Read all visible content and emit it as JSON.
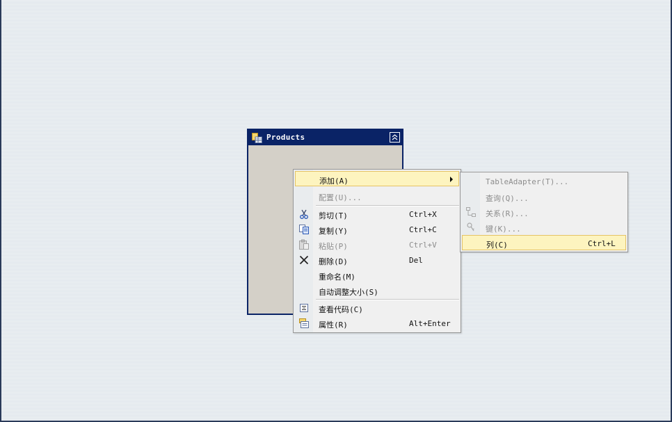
{
  "table": {
    "title": "Products"
  },
  "context_menu": {
    "items": [
      {
        "label": "添加(A)",
        "shortcut": "",
        "icon": "",
        "enabled": true,
        "highlighted": true,
        "submenu": true
      },
      {
        "label": "配置(U)...",
        "shortcut": "",
        "icon": "",
        "enabled": false
      },
      {
        "label": "剪切(T)",
        "shortcut": "Ctrl+X",
        "icon": "scissors-icon",
        "enabled": true
      },
      {
        "label": "复制(Y)",
        "shortcut": "Ctrl+C",
        "icon": "copy-icon",
        "enabled": true
      },
      {
        "label": "粘贴(P)",
        "shortcut": "Ctrl+V",
        "icon": "paste-icon",
        "enabled": false
      },
      {
        "label": "删除(D)",
        "shortcut": "Del",
        "icon": "delete-x-icon",
        "enabled": true
      },
      {
        "label": "重命名(M)",
        "shortcut": "",
        "icon": "",
        "enabled": true
      },
      {
        "label": "自动调整大小(S)",
        "shortcut": "",
        "icon": "",
        "enabled": true
      },
      {
        "label": "查看代码(C)",
        "shortcut": "",
        "icon": "view-code-icon",
        "enabled": true
      },
      {
        "label": "属性(R)",
        "shortcut": "Alt+Enter",
        "icon": "properties-icon",
        "enabled": true
      }
    ]
  },
  "submenu": {
    "items": [
      {
        "label": "TableAdapter(T)...",
        "shortcut": "",
        "icon": "",
        "enabled": false
      },
      {
        "label": "查询(Q)...",
        "shortcut": "",
        "icon": "",
        "enabled": false
      },
      {
        "label": "关系(R)...",
        "shortcut": "",
        "icon": "relation-icon",
        "enabled": false
      },
      {
        "label": "键(K)...",
        "shortcut": "",
        "icon": "key-icon",
        "enabled": false
      },
      {
        "label": "列(C)",
        "shortcut": "Ctrl+L",
        "icon": "",
        "enabled": true,
        "highlighted": true
      }
    ]
  },
  "colors": {
    "header": "#0a2366",
    "highlight": "#fdf4bf",
    "highlight_border": "#e5c365",
    "disabled_text": "#8d8d8d"
  }
}
